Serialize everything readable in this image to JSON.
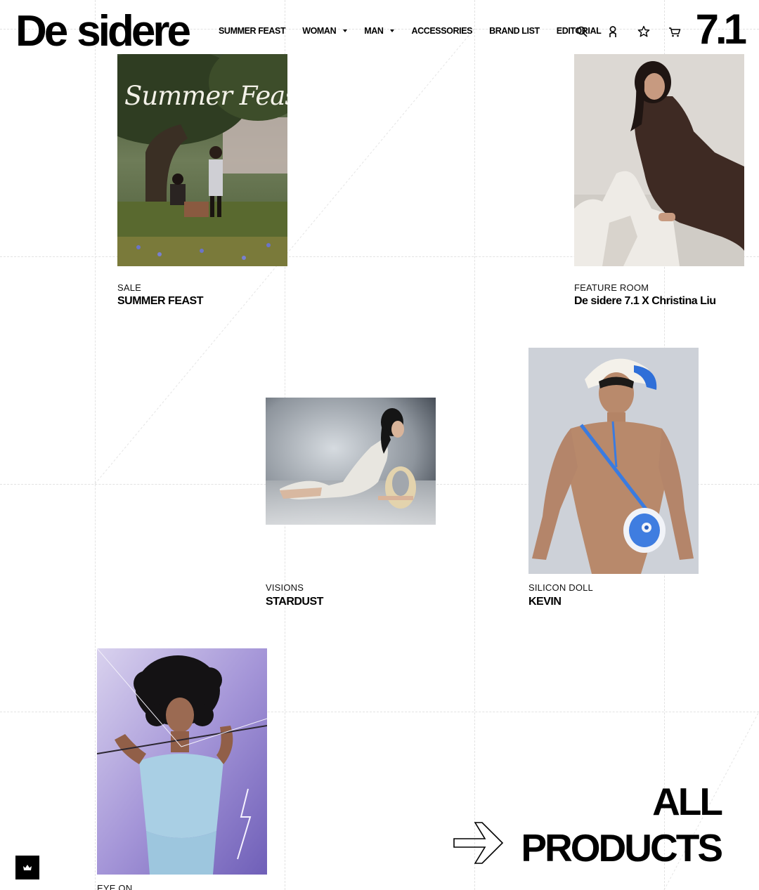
{
  "header": {
    "logo_word_1": "De",
    "logo_word_2": "sidere",
    "brand_mark": "7.1"
  },
  "nav": {
    "items": [
      {
        "label": "SUMMER FEAST",
        "has_dropdown": false
      },
      {
        "label": "WOMAN",
        "has_dropdown": true
      },
      {
        "label": "MAN",
        "has_dropdown": true
      },
      {
        "label": "ACCESSORIES",
        "has_dropdown": false
      },
      {
        "label": "BRAND LIST",
        "has_dropdown": false
      },
      {
        "label": "EDITORIAL",
        "has_dropdown": false
      }
    ],
    "icons": [
      "search-icon",
      "user-icon",
      "star-icon",
      "cart-icon"
    ]
  },
  "cards": [
    {
      "category": "SALE",
      "title": "SUMMER FEAST",
      "image_text": "Summer Feast"
    },
    {
      "category": "FEATURE ROOM",
      "title": "De sidere 7.1 X Christina Liu"
    },
    {
      "category": "VISIONS",
      "title": "STARDUST"
    },
    {
      "category": "SILICON DOLL",
      "title": "KEVIN"
    },
    {
      "category": "EYE ON",
      "title": ""
    }
  ],
  "all_products": {
    "line1": "ALL",
    "line2": "PRODUCTS"
  },
  "floating": {
    "icon": "crown-icon"
  },
  "colors": {
    "background": "#ffffff",
    "text": "#000000",
    "grid": "#e2e2e2"
  }
}
